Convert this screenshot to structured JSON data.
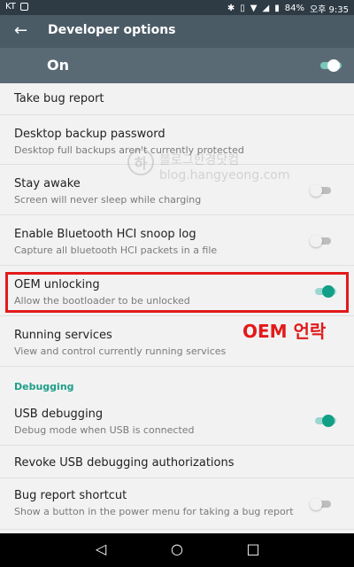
{
  "status": {
    "carrier": "KT",
    "battery": "84%",
    "time": "오후 9:35"
  },
  "appbar": {
    "title": "Developer options"
  },
  "master": {
    "label": "On",
    "state": "on"
  },
  "items": [
    {
      "title": "Take bug report"
    },
    {
      "title": "Desktop backup password",
      "subtitle": "Desktop full backups aren't currently protected"
    },
    {
      "title": "Stay awake",
      "subtitle": "Screen will never sleep while charging",
      "toggle": "off"
    },
    {
      "title": "Enable Bluetooth HCI snoop log",
      "subtitle": "Capture all bluetooth HCI packets in a file",
      "toggle": "off"
    },
    {
      "title": "OEM unlocking",
      "subtitle": "Allow the bootloader to be unlocked",
      "toggle": "on"
    },
    {
      "title": "Running services",
      "subtitle": "View and control currently running services"
    }
  ],
  "section_debugging": {
    "label": "Debugging"
  },
  "debug_items": [
    {
      "title": "USB debugging",
      "subtitle": "Debug mode when USB is connected",
      "toggle": "on"
    },
    {
      "title": "Revoke USB debugging authorizations"
    },
    {
      "title": "Bug report shortcut",
      "subtitle": "Show a button in the power menu for taking a bug report",
      "toggle": "off"
    }
  ],
  "annotation": {
    "label": "OEM 언락"
  },
  "watermark": {
    "korean": "블로그한경닷컴",
    "url": "blog.hangyeong.com"
  },
  "nav": {
    "back": "◁",
    "home": "○",
    "recents": "□"
  }
}
